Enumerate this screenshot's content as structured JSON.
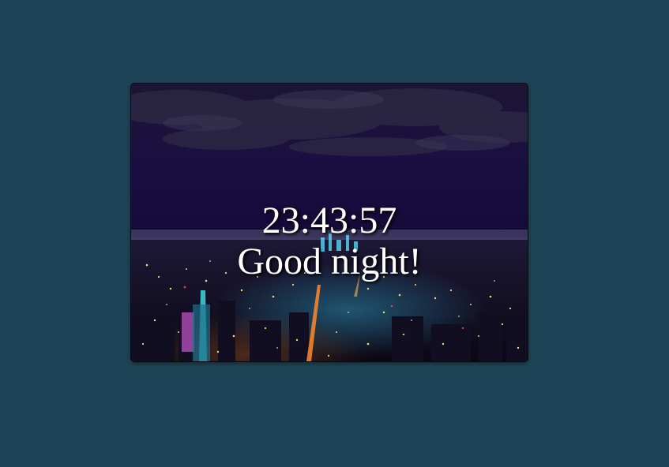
{
  "clock": {
    "time": "23:43:57",
    "greeting": "Good night!"
  },
  "theme": {
    "page_background": "#1f4356",
    "text_color": "#ffffff",
    "sky_color": "#1a0b3d"
  },
  "background_image": {
    "icon": "night-city-skyline-photo"
  }
}
